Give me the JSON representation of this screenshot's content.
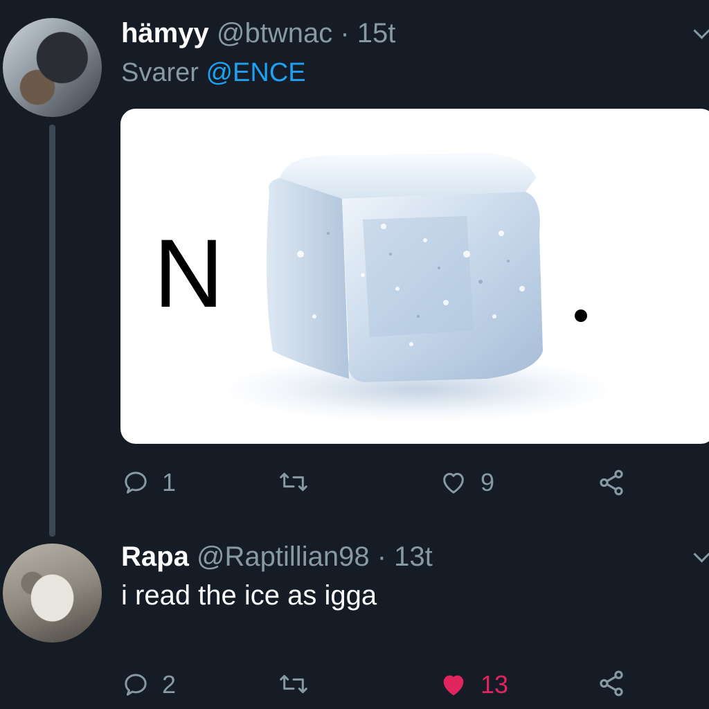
{
  "tweets": [
    {
      "display_name": "hämyy",
      "handle": "@btwnac",
      "separator": "·",
      "time": "15t",
      "reply_prefix": "Svarer",
      "reply_to": "@ENCE",
      "media": {
        "letter": "N"
      },
      "actions": {
        "replies": "1",
        "retweets": "",
        "likes": "9"
      }
    },
    {
      "display_name": "Rapa",
      "handle": "@Raptillian98",
      "separator": "·",
      "time": "13t",
      "text": "i read the ice as igga",
      "actions": {
        "replies": "2",
        "retweets": "",
        "likes": "13",
        "liked": true
      }
    }
  ],
  "icons": [
    "reply-icon",
    "retweet-icon",
    "heart-icon",
    "share-icon",
    "chevron-down-icon"
  ],
  "colors": {
    "background": "#151c26",
    "muted": "#8899a6",
    "mention": "#1da1f2",
    "liked": "#e0245e"
  }
}
